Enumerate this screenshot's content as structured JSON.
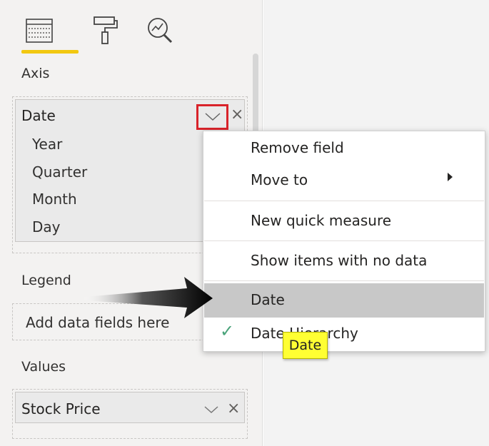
{
  "tabs": [
    {
      "icon": "table-fields-icon"
    },
    {
      "icon": "paint-roller-format-icon"
    },
    {
      "icon": "analytics-magnifier-icon"
    }
  ],
  "sections": {
    "axis": {
      "label": "Axis",
      "field": "Date",
      "hierarchy": [
        "Year",
        "Quarter",
        "Month",
        "Day"
      ],
      "remove_glyph": "×"
    },
    "legend": {
      "label": "Legend",
      "placeholder": "Add data fields here"
    },
    "values": {
      "label": "Values",
      "field": "Stock Price",
      "remove_glyph": "×"
    }
  },
  "context_menu": {
    "items": [
      "Remove field",
      "Move to",
      "New quick measure",
      "Show items with no data",
      "Date",
      "Date Hierarchy"
    ],
    "selected_item": "Date Hierarchy",
    "check_glyph": "✓"
  },
  "tooltip": {
    "text": "Date"
  },
  "colors": {
    "accent_underline": "#f2c811",
    "highlight_box": "#d9232a",
    "tooltip_bg": "#ffff33",
    "check": "#4aa37a"
  }
}
